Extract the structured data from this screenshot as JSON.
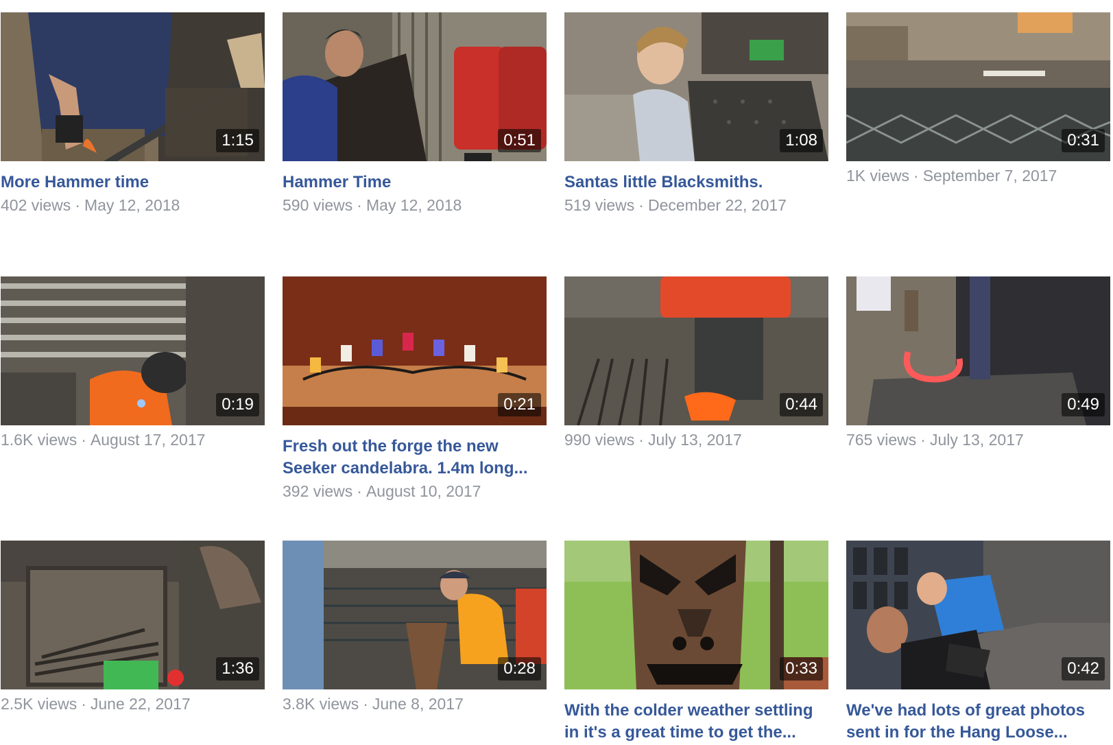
{
  "videos": [
    {
      "title": "More Hammer time",
      "views": "402 views",
      "date": "May 12, 2018",
      "duration": "1:15"
    },
    {
      "title": "Hammer Time",
      "views": "590 views",
      "date": "May 12, 2018",
      "duration": "0:51"
    },
    {
      "title": "Santas little Blacksmiths.",
      "views": "519 views",
      "date": "December 22, 2017",
      "duration": "1:08"
    },
    {
      "title": "",
      "views": "1K views",
      "date": "September 7, 2017",
      "duration": "0:31"
    },
    {
      "title": "",
      "views": "1.6K views",
      "date": "August 17, 2017",
      "duration": "0:19"
    },
    {
      "title_line1": "Fresh out the forge the new",
      "title_line2": "Seeker candelabra. 1.4m long...",
      "views": "392 views",
      "date": "August 10, 2017",
      "duration": "0:21"
    },
    {
      "title": "",
      "views": "990 views",
      "date": "July 13, 2017",
      "duration": "0:44"
    },
    {
      "title": "",
      "views": "765 views",
      "date": "July 13, 2017",
      "duration": "0:49"
    },
    {
      "title": "",
      "views": "2.5K views",
      "date": "June 22, 2017",
      "duration": "1:36"
    },
    {
      "title": "",
      "views": "3.8K views",
      "date": "June 8, 2017",
      "duration": "0:28"
    },
    {
      "title_line1": "With the colder weather settling",
      "title_line2": "in it's a great time to get the...",
      "views": "",
      "date": "",
      "duration": "0:33"
    },
    {
      "title_line1": "We've had lots of great photos",
      "title_line2": "sent in for the Hang Loose...",
      "views": "",
      "date": "",
      "duration": "0:42"
    }
  ],
  "separator": "·",
  "icons": {
    "thumbnail": "video-thumbnail",
    "duration": "duration-badge"
  }
}
